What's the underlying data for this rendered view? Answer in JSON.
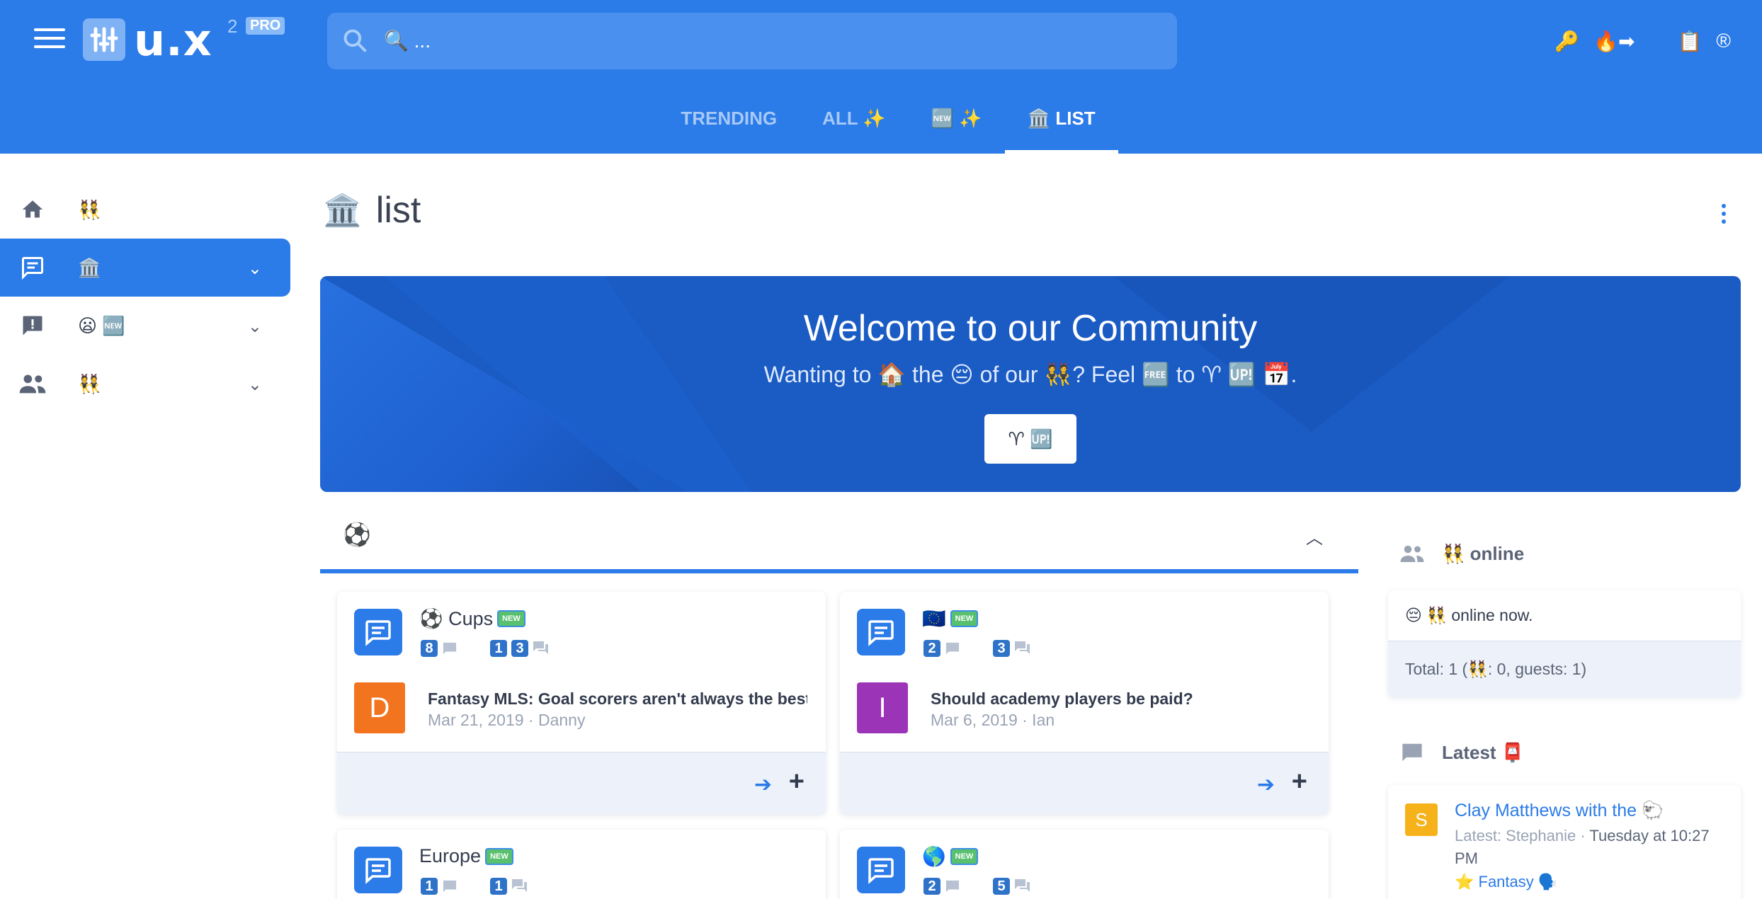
{
  "header": {
    "logo_text": "u.x",
    "logo_sup": "2",
    "logo_badge": "PRO",
    "search_placeholder": "🔍 ...",
    "right_icons": [
      "🔑",
      "🔥➡",
      "📋",
      "®"
    ]
  },
  "tabs": [
    {
      "label": "TRENDING",
      "active": false
    },
    {
      "label": "ALL ✨",
      "active": false
    },
    {
      "label": "🆕 ✨",
      "active": false
    },
    {
      "label": "🏛️ LIST",
      "active": true
    }
  ],
  "sidebar": {
    "items": [
      {
        "icon": "home-icon",
        "label": "👯",
        "active": false,
        "chevron": false
      },
      {
        "icon": "forum-icon",
        "label": "🏛️",
        "active": true,
        "chevron": true
      },
      {
        "icon": "feedback-icon",
        "label": "😦 🆕",
        "active": false,
        "chevron": true
      },
      {
        "icon": "people-icon",
        "label": "👯",
        "active": false,
        "chevron": true
      }
    ]
  },
  "page": {
    "title_emoji": "🏛️",
    "title": "list"
  },
  "banner": {
    "title": "Welcome to our Community",
    "subtitle": "Wanting to 🏠 the 😔 of our 👯? Feel 🆓 to ♈ 🆙 📅.",
    "button_label": "♈ 🆙"
  },
  "section": {
    "emoji": "⚽"
  },
  "cards": [
    {
      "name": "⚽ Cups",
      "badge": "NEW",
      "topics": "8",
      "posts_a": "1",
      "posts_b": "3",
      "post_title": "Fantasy MLS: Goal scorers aren't always the best 🏆",
      "post_meta": "Mar 21, 2019 · Danny",
      "avatar_letter": "D",
      "avatar_color": "#f2741f"
    },
    {
      "name": "🇪🇺",
      "badge": "NEW",
      "topics": "2",
      "posts_a": "",
      "posts_b": "3",
      "post_title": "Should academy players be paid?",
      "post_meta": "Mar 6, 2019 · Ian",
      "avatar_letter": "I",
      "avatar_color": "#9c34b8"
    },
    {
      "name": "Europe",
      "badge": "NEW",
      "topics": "1",
      "posts_a": "",
      "posts_b": "1"
    },
    {
      "name": "🌎",
      "badge": "NEW",
      "topics": "2",
      "posts_a": "",
      "posts_b": "5"
    }
  ],
  "online": {
    "header": "👯 online",
    "now_text": "😔 👯 online now.",
    "total_text": "Total: 1 (👯: 0, guests: 1)"
  },
  "latest": {
    "header": "Latest 📮",
    "title": "Clay Matthews with the 🐑",
    "meta_prefix": "Latest: Stephanie · ",
    "meta_time": "Tuesday at 10:27 PM",
    "category": "⭐ Fantasy 🗣️"
  },
  "colors": {
    "primary": "#2b7be8",
    "banner": "#1a5bc4",
    "text": "#333c4e",
    "muted": "#9aa3b4"
  }
}
